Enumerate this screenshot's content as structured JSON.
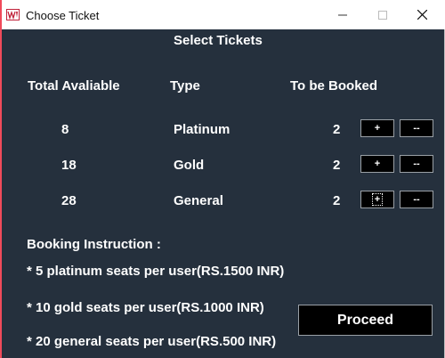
{
  "window": {
    "title": "Choose Ticket",
    "controls": {
      "minimize": "—",
      "maximize": "☐",
      "close": "✕"
    }
  },
  "heading": "Select Tickets",
  "columns": {
    "available": "Total Avaliable",
    "type": "Type",
    "booked": "To be Booked"
  },
  "rows": [
    {
      "available": "8",
      "type": "Platinum",
      "booked": "2",
      "plus": "+",
      "minus": "--"
    },
    {
      "available": "18",
      "type": "Gold",
      "booked": "2",
      "plus": "+",
      "minus": "--"
    },
    {
      "available": "28",
      "type": "General",
      "booked": "2",
      "plus": "+",
      "minus": "--"
    }
  ],
  "instructions": {
    "title": "Booking Instruction :",
    "lines": [
      "* 5 platinum seats per user(RS.1500 INR)",
      "* 10 gold seats per user(RS.1000 INR)",
      "* 20 general seats per user(RS.500 INR)"
    ]
  },
  "proceed_label": "Proceed",
  "colors": {
    "background": "#25303d",
    "button": "#000000",
    "text": "#ffffff",
    "accent_border": "#f04a5a"
  }
}
